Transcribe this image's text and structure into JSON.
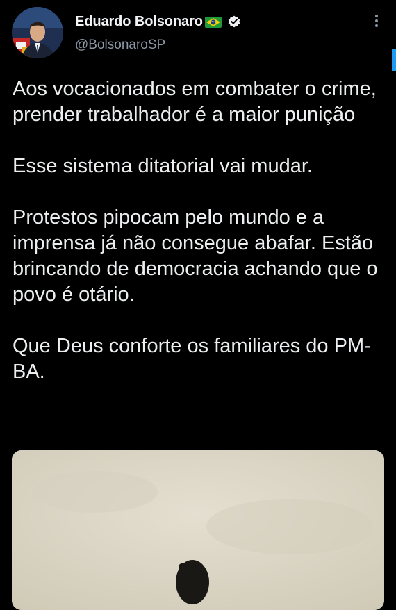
{
  "author": {
    "display_name": "Eduardo Bolsonaro",
    "handle": "@BolsonaroSP",
    "flag_icon": "brazil-flag-icon",
    "verified_icon": "verified-badge-icon"
  },
  "tweet": {
    "paragraphs": [
      "Aos vocacionados em combater o crime, prender trabalhador é a maior punição",
      "Esse sistema ditatorial vai mudar.",
      "Protestos pipocam pelo mundo e a imprensa já não consegue abafar. Estão brincando de democracia achando que o povo é otário.",
      "Que Deus conforte os familiares do PM-BA."
    ]
  },
  "colors": {
    "background": "#000000",
    "text": "#e7e9ea",
    "secondary_text": "#8b98a5",
    "accent": "#1d9bf0"
  },
  "icons": {
    "menu": "more-vertical-icon"
  }
}
